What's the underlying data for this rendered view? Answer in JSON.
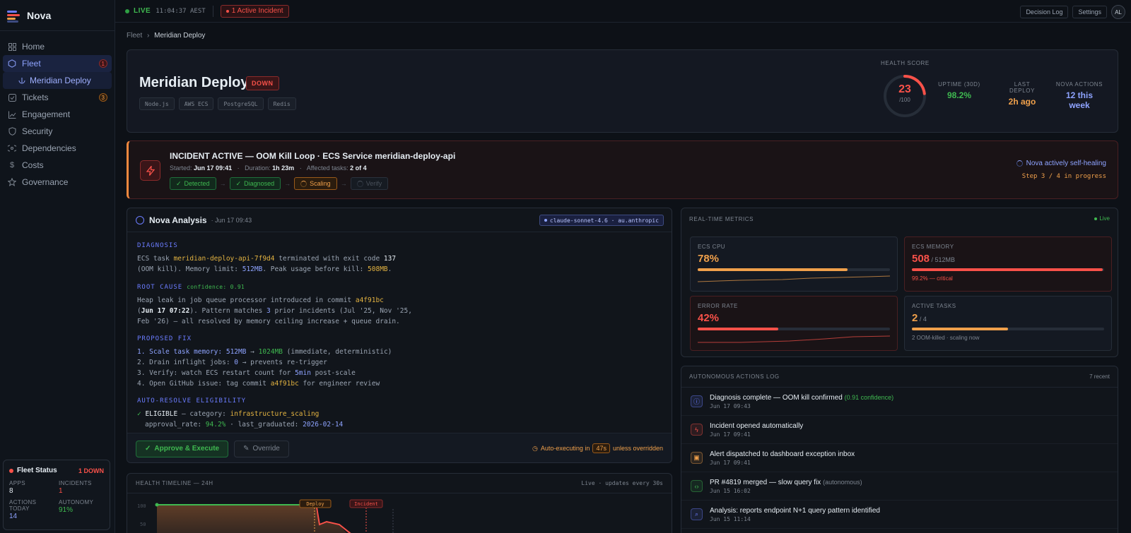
{
  "app": {
    "name": "Nova"
  },
  "colors": {
    "accent": "#6b7cff",
    "danger": "#f85149",
    "warning": "#f0a04b",
    "success": "#3fb950"
  },
  "sidebar": {
    "items": [
      {
        "label": "Home",
        "icon": "grid-icon"
      },
      {
        "label": "Fleet",
        "icon": "hexagon-icon",
        "badge": "1",
        "active": true
      },
      {
        "label": "Meridian Deploy",
        "icon": "anchor-icon",
        "sub": true
      },
      {
        "label": "Tickets",
        "icon": "checkbox-icon",
        "badge": "3"
      },
      {
        "label": "Engagement",
        "icon": "chart-line-icon"
      },
      {
        "label": "Security",
        "icon": "shield-icon"
      },
      {
        "label": "Dependencies",
        "icon": "link-icon"
      },
      {
        "label": "Costs",
        "icon": "dollar-icon"
      },
      {
        "label": "Governance",
        "icon": "star-icon"
      }
    ],
    "fleet_status": {
      "title": "Fleet Status",
      "down": "1 DOWN",
      "apps_label": "APPS",
      "apps": "8",
      "incidents_label": "INCIDENTS",
      "incidents": "1",
      "actions_label_1": "ACTIONS",
      "actions_label_2": "TODAY",
      "actions": "14",
      "autonomy_label": "AUTONOMY",
      "autonomy": "91%"
    }
  },
  "topbar": {
    "live": "LIVE",
    "clock": "11:04:37 AEST",
    "incident": "1 Active Incident",
    "decision_log": "Decision Log",
    "settings": "Settings",
    "avatar": "AL"
  },
  "breadcrumb": {
    "root": "Fleet",
    "current": "Meridian Deploy"
  },
  "header": {
    "title": "Meridian Deploy",
    "status": "DOWN",
    "tags": [
      "Node.js",
      "AWS ECS",
      "PostgreSQL",
      "Redis"
    ],
    "health_label": "HEALTH SCORE",
    "health": "23",
    "health_max": "/100",
    "health_value": 23,
    "uptime_label": "UPTIME (30D)",
    "uptime": "98.2%",
    "deploy_label": "LAST DEPLOY",
    "deploy": "2h ago",
    "actions_label": "NOVA ACTIONS",
    "actions": "12 this week"
  },
  "incident": {
    "title": "INCIDENT ACTIVE — OOM Kill Loop · ECS Service meridian-deploy-api",
    "started_label": "Started:",
    "started": "Jun 17 09:41",
    "duration_label": "Duration:",
    "duration": "1h 23m",
    "affected_label": "Affected tasks:",
    "affected": "2 of 4",
    "steps": [
      {
        "label": "Detected",
        "state": "done"
      },
      {
        "label": "Diagnosed",
        "state": "done"
      },
      {
        "label": "Scaling",
        "state": "current"
      },
      {
        "label": "Verify",
        "state": "todo"
      }
    ],
    "healing": "Nova actively self-healing",
    "progress": "Step 3 / 4 in progress"
  },
  "analysis": {
    "title": "Nova Analysis",
    "date": "· Jun 17 09:43",
    "model": "claude-sonnet-4.6 · au.anthropic",
    "diagnosis_h": "DIAGNOSIS",
    "d1a": "ECS task ",
    "d1b": "meridian-deploy-api-7f9d4",
    "d1c": " terminated with exit code ",
    "d1d": "137",
    "d2a": "(OOM kill). Memory limit: ",
    "d2b": "512MB",
    "d2c": ". Peak usage before kill: ",
    "d2d": "508MB",
    "d2e": ".",
    "root_h": "ROOT CAUSE",
    "confidence": "confidence: 0.91",
    "r1a": "Heap leak in job queue processor introduced in commit ",
    "r1b": "a4f91bc",
    "r2a": "(",
    "r2b": "Jun 17 07:22",
    "r2c": "). Pattern matches ",
    "r2d": "3",
    "r2e": " prior incidents (Jul '25, Nov '25,",
    "r3": "Feb '26) — all resolved by memory ceiling increase + queue drain.",
    "fix_h": "PROPOSED FIX",
    "f1a": "1. Scale task memory: ",
    "f1b": "512MB",
    "f1c": " → ",
    "f1d": "1024MB",
    "f1e": " (immediate, deterministic)",
    "f2a": "2. Drain inflight jobs: ",
    "f2b": "0",
    "f2c": " → prevents re-trigger",
    "f3a": "3. Verify: watch ECS restart count for ",
    "f3b": "5min",
    "f3c": " post-scale",
    "f4a": "4. Open GitHub issue: tag commit ",
    "f4b": "a4f91bc",
    "f4c": " for engineer review",
    "elig_h": "AUTO-RESOLVE ELIGIBILITY",
    "e1a": "✓ ",
    "e1b": "ELIGIBLE",
    "e1c": " — category: ",
    "e1d": "infrastructure_scaling",
    "e2a": "approval_rate: ",
    "e2b": "94.2%",
    "e2c": " · last_graduated: ",
    "e2d": "2026-02-14",
    "approve": "Approve & Execute",
    "override": "Override",
    "auto_a": "Auto-executing in",
    "countdown": "47s",
    "auto_b": "unless overridden"
  },
  "timeline": {
    "title": "HEALTH TIMELINE — 24H",
    "live": "Live · updates every 30s",
    "y_ticks": [
      "100",
      "50"
    ],
    "markers": [
      "Deploy",
      "Incident"
    ]
  },
  "metrics": {
    "title": "REAL-TIME METRICS",
    "live": "Live",
    "tiles": [
      {
        "label": "ECS CPU",
        "value": "78%",
        "sub": "",
        "fill": 0.78,
        "color": "#f0a04b",
        "note": ""
      },
      {
        "label": "ECS MEMORY",
        "value": "508",
        "sub": " / 512MB",
        "fill": 0.992,
        "color": "#f85149",
        "note": "99.2% — critical"
      },
      {
        "label": "ERROR RATE",
        "value": "42%",
        "sub": "",
        "fill": 0.42,
        "color": "#f85149",
        "note": ""
      },
      {
        "label": "ACTIVE TASKS",
        "value": "2",
        "sub": " / 4",
        "fill": 0.5,
        "color": "#f0a04b",
        "note": "2 OOM-killed · scaling now"
      }
    ]
  },
  "actions_log": {
    "title": "AUTONOMOUS ACTIONS LOG",
    "count": "7 recent",
    "rows": [
      {
        "icon": "info-icon",
        "text": "Diagnosis complete — OOM kill confirmed ",
        "extra": "(0.91 confidence)",
        "time": "Jun 17 09:43",
        "color": "#6b7cff",
        "extra_color": "#3fb950"
      },
      {
        "icon": "bolt-icon",
        "text": "Incident opened automatically",
        "extra": "",
        "time": "Jun 17 09:41",
        "color": "#f85149",
        "extra_color": ""
      },
      {
        "icon": "bell-icon",
        "text": "Alert dispatched to dashboard exception inbox",
        "extra": "",
        "time": "Jun 17 09:41",
        "color": "#f0a04b",
        "extra_color": ""
      },
      {
        "icon": "code-icon",
        "text": "PR #4819 merged — slow query fix ",
        "extra": "(autonomous)",
        "time": "Jun 15 16:02",
        "color": "#3fb950",
        "extra_color": "#7d8590"
      },
      {
        "icon": "search-icon",
        "text": "Analysis: reports endpoint N+1 query pattern identified",
        "extra": "",
        "time": "Jun 15 11:14",
        "color": "#6b7cff",
        "extra_color": ""
      }
    ]
  }
}
